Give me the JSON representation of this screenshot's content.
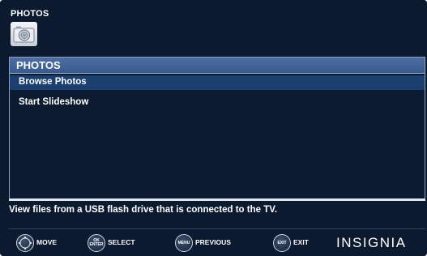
{
  "header": {
    "title": "PHOTOS",
    "icon": "camera-icon"
  },
  "menu": {
    "title": "PHOTOS",
    "items": [
      {
        "label": "Browse Photos",
        "selected": true
      },
      {
        "label": "Start Slideshow",
        "selected": false
      }
    ]
  },
  "description": "View files from a USB flash drive that is connected to the TV.",
  "footer": {
    "hints": [
      {
        "button": "",
        "label": "MOVE",
        "icon": "dpad-icon"
      },
      {
        "button": "OK ENTER",
        "label": "SELECT",
        "icon": "ok-enter-icon"
      },
      {
        "button": "MENU",
        "label": "PREVIOUS",
        "icon": "menu-icon"
      },
      {
        "button": "EXIT",
        "label": "EXIT",
        "icon": "exit-icon"
      }
    ],
    "brand": "INSIGNIA"
  },
  "colors": {
    "background": "#0b1a2e",
    "title_bar": "#4d6ea2",
    "selected_row": "#1b3f6e",
    "text": "#ffffff"
  }
}
